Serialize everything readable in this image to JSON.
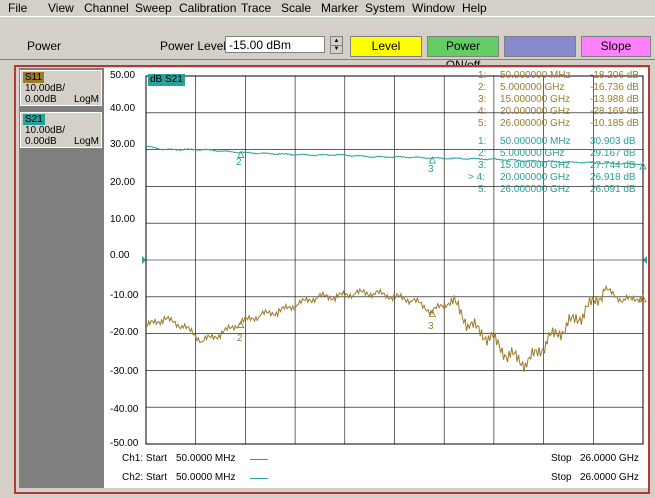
{
  "menu": [
    "File",
    "View",
    "Channel",
    "Sweep",
    "Calibration",
    "Trace",
    "Scale",
    "Marker",
    "System",
    "Window",
    "Help"
  ],
  "toolbar": {
    "group_label": "Power",
    "field_label": "Power Level",
    "field_value": "-15.00 dBm",
    "buttons": [
      {
        "label": "Level",
        "color": "#ffff00"
      },
      {
        "label": "Power ON/off",
        "color": "#66cc66"
      },
      {
        "label": "",
        "color": "#8888cc"
      },
      {
        "label": "Slope",
        "color": "#ff80ff"
      }
    ]
  },
  "traces": [
    {
      "name": "S11",
      "scale": "10.00dB/",
      "ref": "0.00dB",
      "format": "LogM",
      "color": "#9c7a2a"
    },
    {
      "name": "S21",
      "scale": "10.00dB/",
      "ref": "0.00dB",
      "format": "LogM",
      "color": "#2aa198"
    }
  ],
  "plot": {
    "active_trace_label": "dB S21",
    "y_ticks": [
      "50.00",
      "40.00",
      "30.00",
      "20.00",
      "10.00",
      "0.00",
      "-10.00",
      "-20.00",
      "-30.00",
      "-40.00",
      "-50.00"
    ]
  },
  "markers_s11": [
    {
      "num": "1:",
      "freq": "50.000000 MHz",
      "value": "-18.206 dB"
    },
    {
      "num": "2:",
      "freq": "5.000000 GHz",
      "value": "-16.736 dB"
    },
    {
      "num": "3:",
      "freq": "15.000000 GHz",
      "value": "-13.988 dB"
    },
    {
      "num": "4:",
      "freq": "20.000000 GHz",
      "value": "-28.169 dB"
    },
    {
      "num": "5:",
      "freq": "26.000000 GHz",
      "value": "-10.185 dB"
    }
  ],
  "markers_s21": [
    {
      "num": "1:",
      "freq": "50.000000 MHz",
      "value": "30.903 dB"
    },
    {
      "num": "2:",
      "freq": "5.000000 GHz",
      "value": "29.167 dB"
    },
    {
      "num": "3:",
      "freq": "15.000000 GHz",
      "value": "27.744 dB"
    },
    {
      "num": "> 4:",
      "freq": "20.000000 GHz",
      "value": "26.918 dB"
    },
    {
      "num": "5:",
      "freq": "26.000000 GHz",
      "value": "26.091 dB"
    }
  ],
  "trace_marker_labels": [
    "2",
    "3"
  ],
  "channels": {
    "ch1": {
      "label": "Ch1: Start",
      "start": "50.0000 MHz",
      "stop_label": "Stop",
      "stop": "26.0000 GHz"
    },
    "ch2": {
      "label": "Ch2: Start",
      "start": "50.0000 MHz",
      "stop_label": "Stop",
      "stop": "26.0000 GHz"
    }
  },
  "chart_data": {
    "type": "line",
    "ylim": [
      -50,
      50
    ],
    "xlim_ghz": [
      0.05,
      26
    ],
    "grid": true,
    "series": [
      {
        "name": "S11",
        "x_ghz": [
          0.05,
          1,
          2,
          3,
          4,
          5,
          6,
          7,
          8,
          9,
          10,
          11,
          12,
          13,
          14,
          15,
          16,
          17,
          18,
          19,
          20,
          21,
          22,
          23,
          24,
          25,
          26
        ],
        "values": [
          -18,
          -16,
          -18,
          -22,
          -20,
          -17,
          -15,
          -14,
          -12,
          -10,
          -10,
          -9,
          -9,
          -10,
          -11,
          -14,
          -11,
          -18,
          -21,
          -26,
          -28,
          -22,
          -18,
          -14,
          -8,
          -11,
          -10
        ]
      },
      {
        "name": "S21",
        "x_ghz": [
          0.05,
          1,
          2,
          3,
          4,
          5,
          6,
          7,
          8,
          9,
          10,
          11,
          12,
          13,
          14,
          15,
          16,
          17,
          18,
          19,
          20,
          21,
          22,
          23,
          24,
          25,
          26
        ],
        "values": [
          30.9,
          30,
          30,
          30,
          29.6,
          29.2,
          29,
          28.8,
          28.6,
          28.5,
          28.6,
          28.3,
          28,
          28,
          27.9,
          27.7,
          27.6,
          27.5,
          27.4,
          27.2,
          26.9,
          26.8,
          26.6,
          26.5,
          26.3,
          26.2,
          26.1
        ]
      }
    ]
  }
}
